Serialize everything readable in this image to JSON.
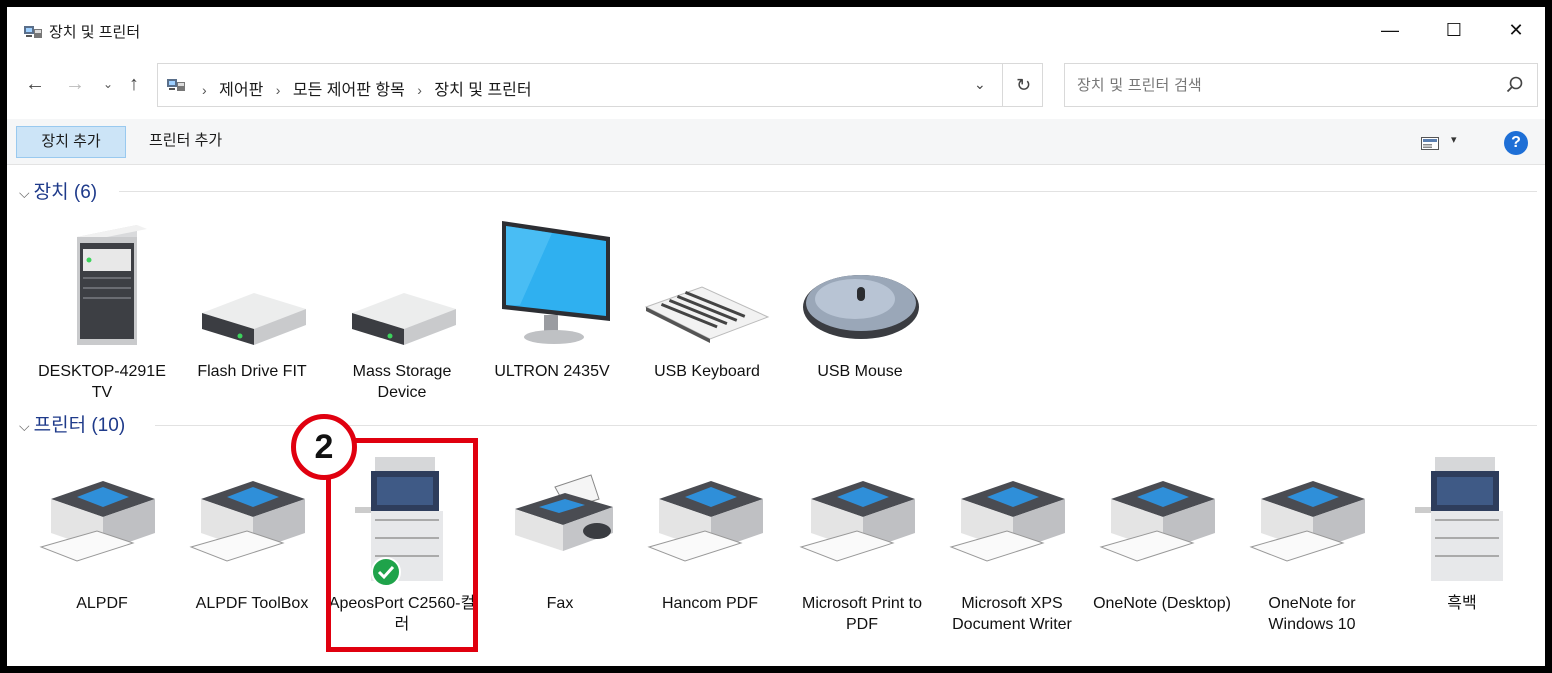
{
  "window": {
    "title": "장치 및 프린터",
    "minimize_glyph": "—",
    "maximize_glyph": "☐",
    "close_glyph": "✕"
  },
  "nav": {
    "back_glyph": "←",
    "forward_glyph": "→",
    "history_glyph": "⌄",
    "up_glyph": "↑",
    "breadcrumb": [
      "제어판",
      "모든 제어판 항목",
      "장치 및 프린터"
    ],
    "crumb_separator": "›",
    "dropdown_glyph": "⌄",
    "refresh_glyph": "↻"
  },
  "search": {
    "placeholder": "장치 및 프린터 검색",
    "icon": "search-icon"
  },
  "toolbar": {
    "add_device_label": "장치 추가",
    "add_printer_label": "프린터 추가",
    "view_dropdown_glyph": "▾",
    "help_label": "?"
  },
  "groups": {
    "devices": {
      "chevron": "⌵",
      "label": "장치",
      "count": "(6)",
      "items": [
        {
          "label": "DESKTOP-4291E TV",
          "icon": "desktop-tower-icon"
        },
        {
          "label": "Flash Drive FIT",
          "icon": "external-drive-icon"
        },
        {
          "label": "Mass Storage Device",
          "icon": "external-drive-icon"
        },
        {
          "label": "ULTRON 2435V",
          "icon": "monitor-icon"
        },
        {
          "label": "USB Keyboard",
          "icon": "keyboard-icon"
        },
        {
          "label": "USB Mouse",
          "icon": "mouse-icon"
        }
      ]
    },
    "printers": {
      "chevron": "⌵",
      "label": "프린터",
      "count": "(10)",
      "items": [
        {
          "label": "ALPDF",
          "icon": "printer-icon"
        },
        {
          "label": "ALPDF ToolBox",
          "icon": "printer-icon"
        },
        {
          "label": "ApeosPort C2560-컬러",
          "icon": "copier-icon",
          "default": true
        },
        {
          "label": "Fax",
          "icon": "fax-icon"
        },
        {
          "label": "Hancom PDF",
          "icon": "printer-icon"
        },
        {
          "label": "Microsoft Print to PDF",
          "icon": "printer-icon"
        },
        {
          "label": "Microsoft XPS Document Writer",
          "icon": "printer-icon"
        },
        {
          "label": "OneNote (Desktop)",
          "icon": "printer-icon"
        },
        {
          "label": "OneNote for Windows 10",
          "icon": "printer-icon"
        },
        {
          "label": "흑백",
          "icon": "copier-icon"
        }
      ]
    }
  },
  "annotation": {
    "step_number": "2",
    "color": "#e0000f"
  },
  "colors": {
    "accent": "#1e6fd6",
    "group_header": "#1e3a8a",
    "selected_button": "#cce4f7",
    "default_check": "#1fa34a"
  }
}
